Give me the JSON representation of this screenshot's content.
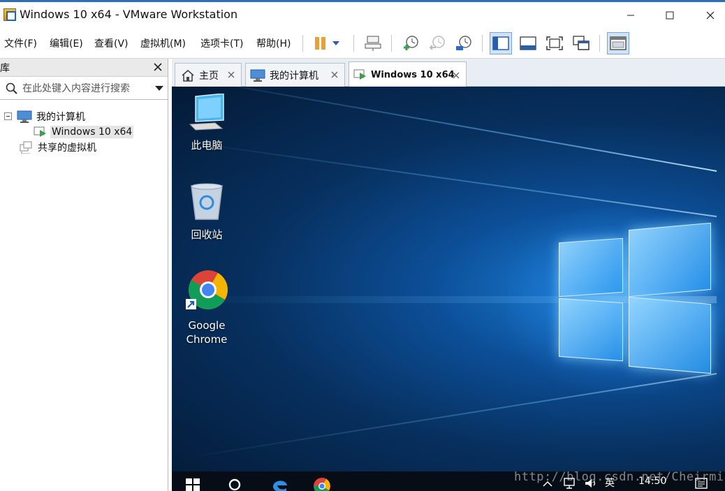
{
  "window": {
    "title": "Windows 10 x64 - VMware Workstation"
  },
  "menu": {
    "items": [
      "文件(F)",
      "编辑(E)",
      "查看(V)",
      "虚拟机(M)",
      "选项卡(T)",
      "帮助(H)"
    ]
  },
  "toolbar": {
    "buttons": [
      {
        "icon": "pause-icon"
      },
      {
        "icon": "dropdown-arrow-icon"
      },
      {
        "icon": "send-ctrl-alt-del-icon"
      },
      {
        "icon": "take-snapshot-icon"
      },
      {
        "icon": "revert-snapshot-icon"
      },
      {
        "icon": "snapshot-manager-icon"
      },
      {
        "icon": "show-library-icon",
        "active": true
      },
      {
        "icon": "thumbnail-bar-icon"
      },
      {
        "icon": "full-screen-icon"
      },
      {
        "icon": "unity-icon"
      },
      {
        "icon": "console-view-icon"
      }
    ]
  },
  "library": {
    "title": "库",
    "search_placeholder": "在此处键入内容进行搜索",
    "tree": [
      {
        "label": "我的计算机",
        "icon": "computer-icon",
        "expanded": true
      },
      {
        "label": "Windows 10 x64",
        "icon": "vm-running-icon",
        "selected": true
      },
      {
        "label": "共享的虚拟机",
        "icon": "shared-vms-icon"
      }
    ]
  },
  "tabs": [
    {
      "label": "主页",
      "icon": "home-icon"
    },
    {
      "label": "我的计算机",
      "icon": "computer-icon"
    },
    {
      "label": "Windows 10 x64",
      "icon": "vm-running-icon",
      "active": true
    }
  ],
  "guest": {
    "desktop_icons": [
      {
        "label": "此电脑",
        "icon": "this-pc-icon"
      },
      {
        "label": "回收站",
        "icon": "recycle-bin-icon"
      },
      {
        "label": "Google Chrome",
        "icon": "chrome-icon"
      }
    ],
    "taskbar": {
      "items": [
        "start-icon",
        "search-icon",
        "edge-icon",
        "chrome-icon"
      ],
      "ime": "英",
      "clock": "14:50"
    }
  },
  "watermark": "http://blog.csdn.net/Cheirmin",
  "colors": {
    "accent": "#2f6fb6",
    "desktop_blue": "#0c4f98",
    "taskbar": "#070d16"
  }
}
